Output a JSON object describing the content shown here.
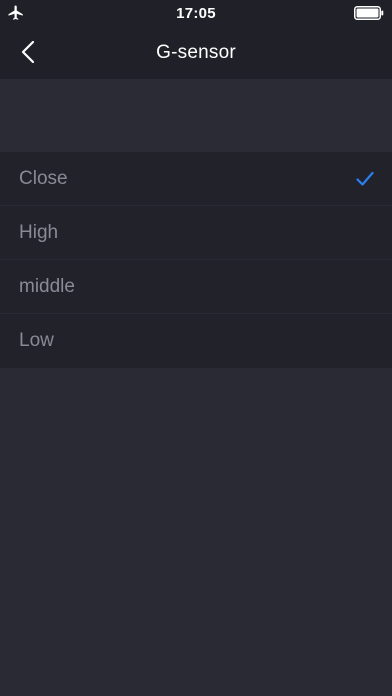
{
  "status_bar": {
    "time": "17:05",
    "airplane_icon": "airplane-icon",
    "battery_icon": "battery-icon"
  },
  "nav": {
    "title": "G-sensor",
    "back_icon": "chevron-left-icon"
  },
  "options": {
    "items": [
      {
        "label": "Close",
        "selected": true
      },
      {
        "label": "High",
        "selected": false
      },
      {
        "label": "middle",
        "selected": false
      },
      {
        "label": "Low",
        "selected": false
      }
    ],
    "check_icon": "checkmark-icon"
  },
  "colors": {
    "background": "#2a2a35",
    "nav_background": "#202028",
    "list_background": "#22222b",
    "label_text": "#8a8a96",
    "title_text": "#ffffff",
    "accent": "#2b7ff0"
  }
}
